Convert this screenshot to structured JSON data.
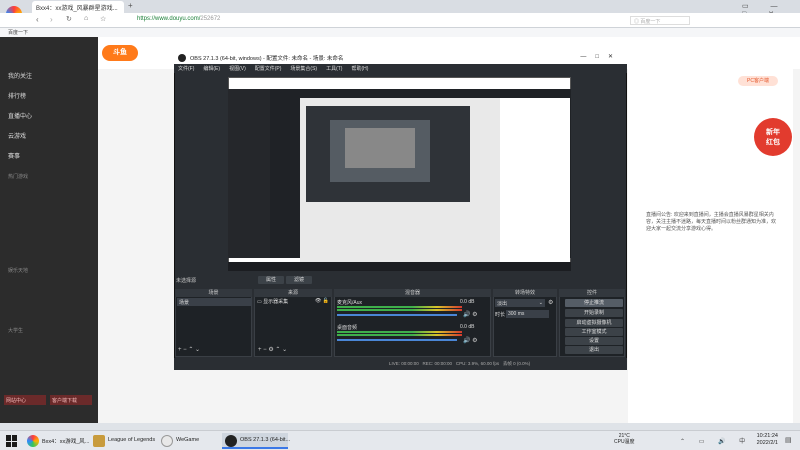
{
  "browser": {
    "tab_title": "Bxx4：xx游戏_风暴群星游戏...",
    "url_prefix": "https://",
    "url_host": "www.douyu.com/",
    "url_path": "252672",
    "bookmark": "百度一下"
  },
  "sidebar": {
    "items": [
      "我的关注",
      "排行榜",
      "直播中心",
      "云游戏",
      "赛事"
    ],
    "headings": [
      "热门游戏",
      "娱乐天地",
      "大学生"
    ],
    "buttons": [
      "网站中心",
      "客户端下载"
    ]
  },
  "right_panel": {
    "ad_line1": "新年",
    "ad_line2": "红包",
    "pc_label": "PC客户端",
    "intro_text": "直播间公告: 欢迎来到直播间，主播会直播风暴群星相关内容，关注主播不迷路，每天直播时间以粉丝群通知为准，欢迎大家一起交流分享游戏心得。"
  },
  "obs": {
    "title": "OBS 27.1.3 (64-bit, windows) - 配置文件: 未命名 - 场景: 未命名",
    "menu": [
      "文件(F)",
      "编辑(E)",
      "视图(V)",
      "配置文件(P)",
      "场景集合(S)",
      "工具(T)",
      "帮助(H)"
    ],
    "source_status": "未选择源",
    "tab_props": "属性",
    "tab_filters": "滤镜",
    "docks": {
      "scenes": "场景",
      "sources": "来源",
      "mixer": "混音器",
      "transitions": "转场特效",
      "controls": "控件"
    },
    "scene_item": "场景",
    "source_item": "显示器采集",
    "mixer": [
      {
        "name": "麦克风/Aux",
        "level": "0.0 dB"
      },
      {
        "name": "桌面音频",
        "level": "0.0 dB"
      }
    ],
    "transition_select": "淡出",
    "duration_label": "时长",
    "duration_value": "300 ms",
    "controls": [
      "停止推流",
      "开始录制",
      "启动虚拟摄像机",
      "工作室模式",
      "设置",
      "退出"
    ],
    "status": {
      "live": "LIVE: 00:00:00",
      "rec": "REC: 00:00:00",
      "cpu": "CPU: 3.9%, 60.00 fps",
      "drop": "丢帧 0 (0.0%)"
    }
  },
  "taskbar": {
    "tasks": [
      "Bxx4：xx游戏_风...",
      "League of Legends",
      "WeGame",
      "OBS 27.1.3 (64-bit..."
    ],
    "weather_temp": "21°C",
    "weather_desc": "CPU温度",
    "time": "10:21:24",
    "date": "2022/2/1"
  }
}
